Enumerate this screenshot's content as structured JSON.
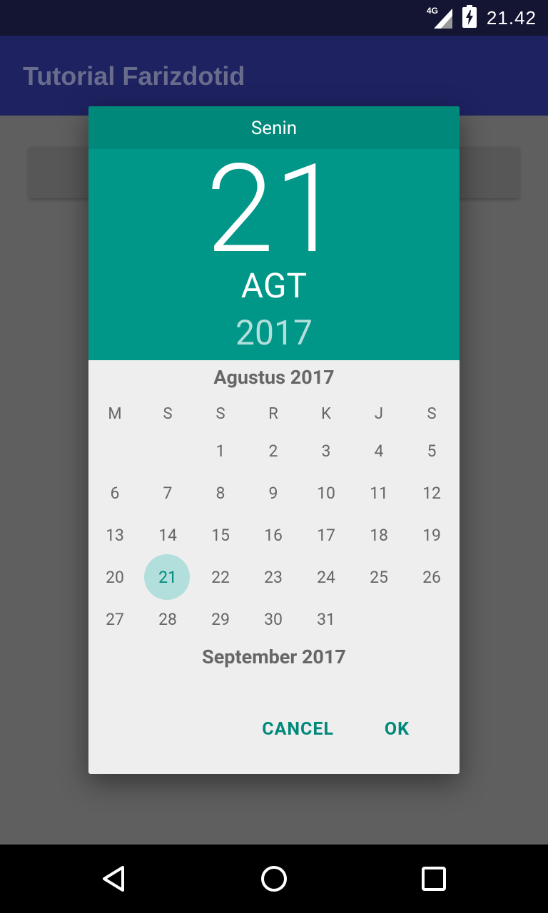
{
  "status": {
    "network": "4G",
    "time": "21.42"
  },
  "app": {
    "title": "Tutorial Farizdotid"
  },
  "dialog": {
    "day_of_week": "Senin",
    "day": "21",
    "month": "AGT",
    "year": "2017",
    "month_title": "Agustus 2017",
    "next_month_title": "September 2017",
    "weekdays": [
      "M",
      "S",
      "S",
      "R",
      "K",
      "J",
      "S"
    ],
    "days": [
      "1",
      "2",
      "3",
      "4",
      "5",
      "6",
      "7",
      "8",
      "9",
      "10",
      "11",
      "12",
      "13",
      "14",
      "15",
      "16",
      "17",
      "18",
      "19",
      "20",
      "21",
      "22",
      "23",
      "24",
      "25",
      "26",
      "27",
      "28",
      "29",
      "30",
      "31"
    ],
    "selected_day": "21",
    "cancel_label": "CANCEL",
    "ok_label": "OK"
  },
  "colors": {
    "accent": "#009688",
    "accent_dark": "#00897b",
    "selection": "#b2dfdb",
    "appbar": "#1e2261"
  },
  "nav": {
    "icons": [
      "back-icon",
      "home-icon",
      "recents-icon"
    ]
  }
}
